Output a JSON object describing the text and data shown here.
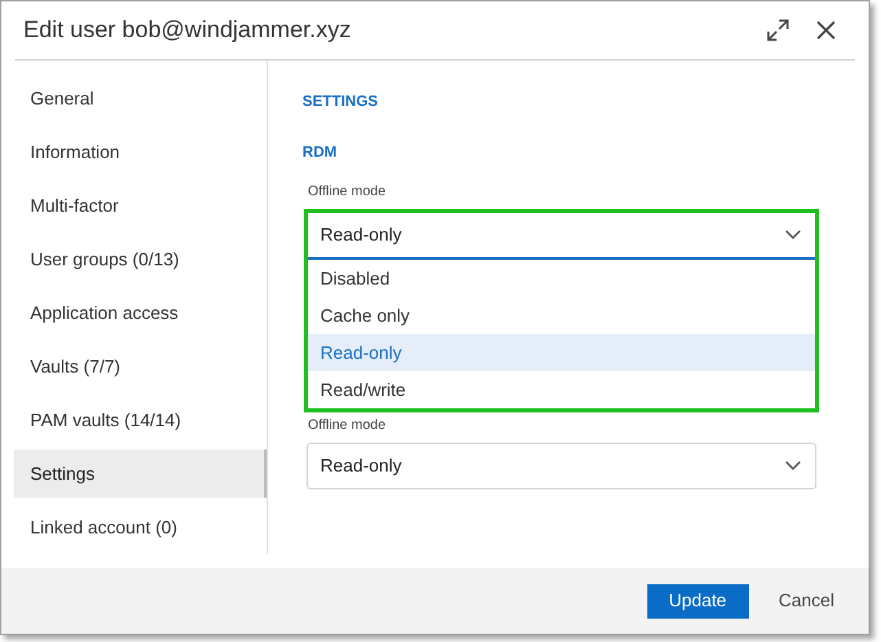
{
  "window": {
    "title": "Edit user bob@windjammer.xyz"
  },
  "sidebar": {
    "items": [
      {
        "label": "General",
        "selected": false
      },
      {
        "label": "Information",
        "selected": false
      },
      {
        "label": "Multi-factor",
        "selected": false
      },
      {
        "label": "User groups (0/13)",
        "selected": false
      },
      {
        "label": "Application access",
        "selected": false
      },
      {
        "label": "Vaults (7/7)",
        "selected": false
      },
      {
        "label": "PAM vaults (14/14)",
        "selected": false
      },
      {
        "label": "Settings",
        "selected": true
      },
      {
        "label": "Linked account (0)",
        "selected": false
      }
    ]
  },
  "content": {
    "heading": "SETTINGS",
    "sections": [
      {
        "heading": "RDM",
        "field": {
          "label": "Offline mode",
          "value": "Read-only",
          "expanded": true,
          "options": [
            {
              "label": "Disabled",
              "selected": false
            },
            {
              "label": "Cache only",
              "selected": false
            },
            {
              "label": "Read-only",
              "selected": true
            },
            {
              "label": "Read/write",
              "selected": false
            }
          ]
        }
      },
      {
        "field": {
          "label": "Offline mode",
          "value": "Read-only",
          "expanded": false
        }
      }
    ]
  },
  "buttons": [
    {
      "label": "Update",
      "kind": "primary"
    },
    {
      "label": "Cancel",
      "kind": "secondary"
    }
  ]
}
